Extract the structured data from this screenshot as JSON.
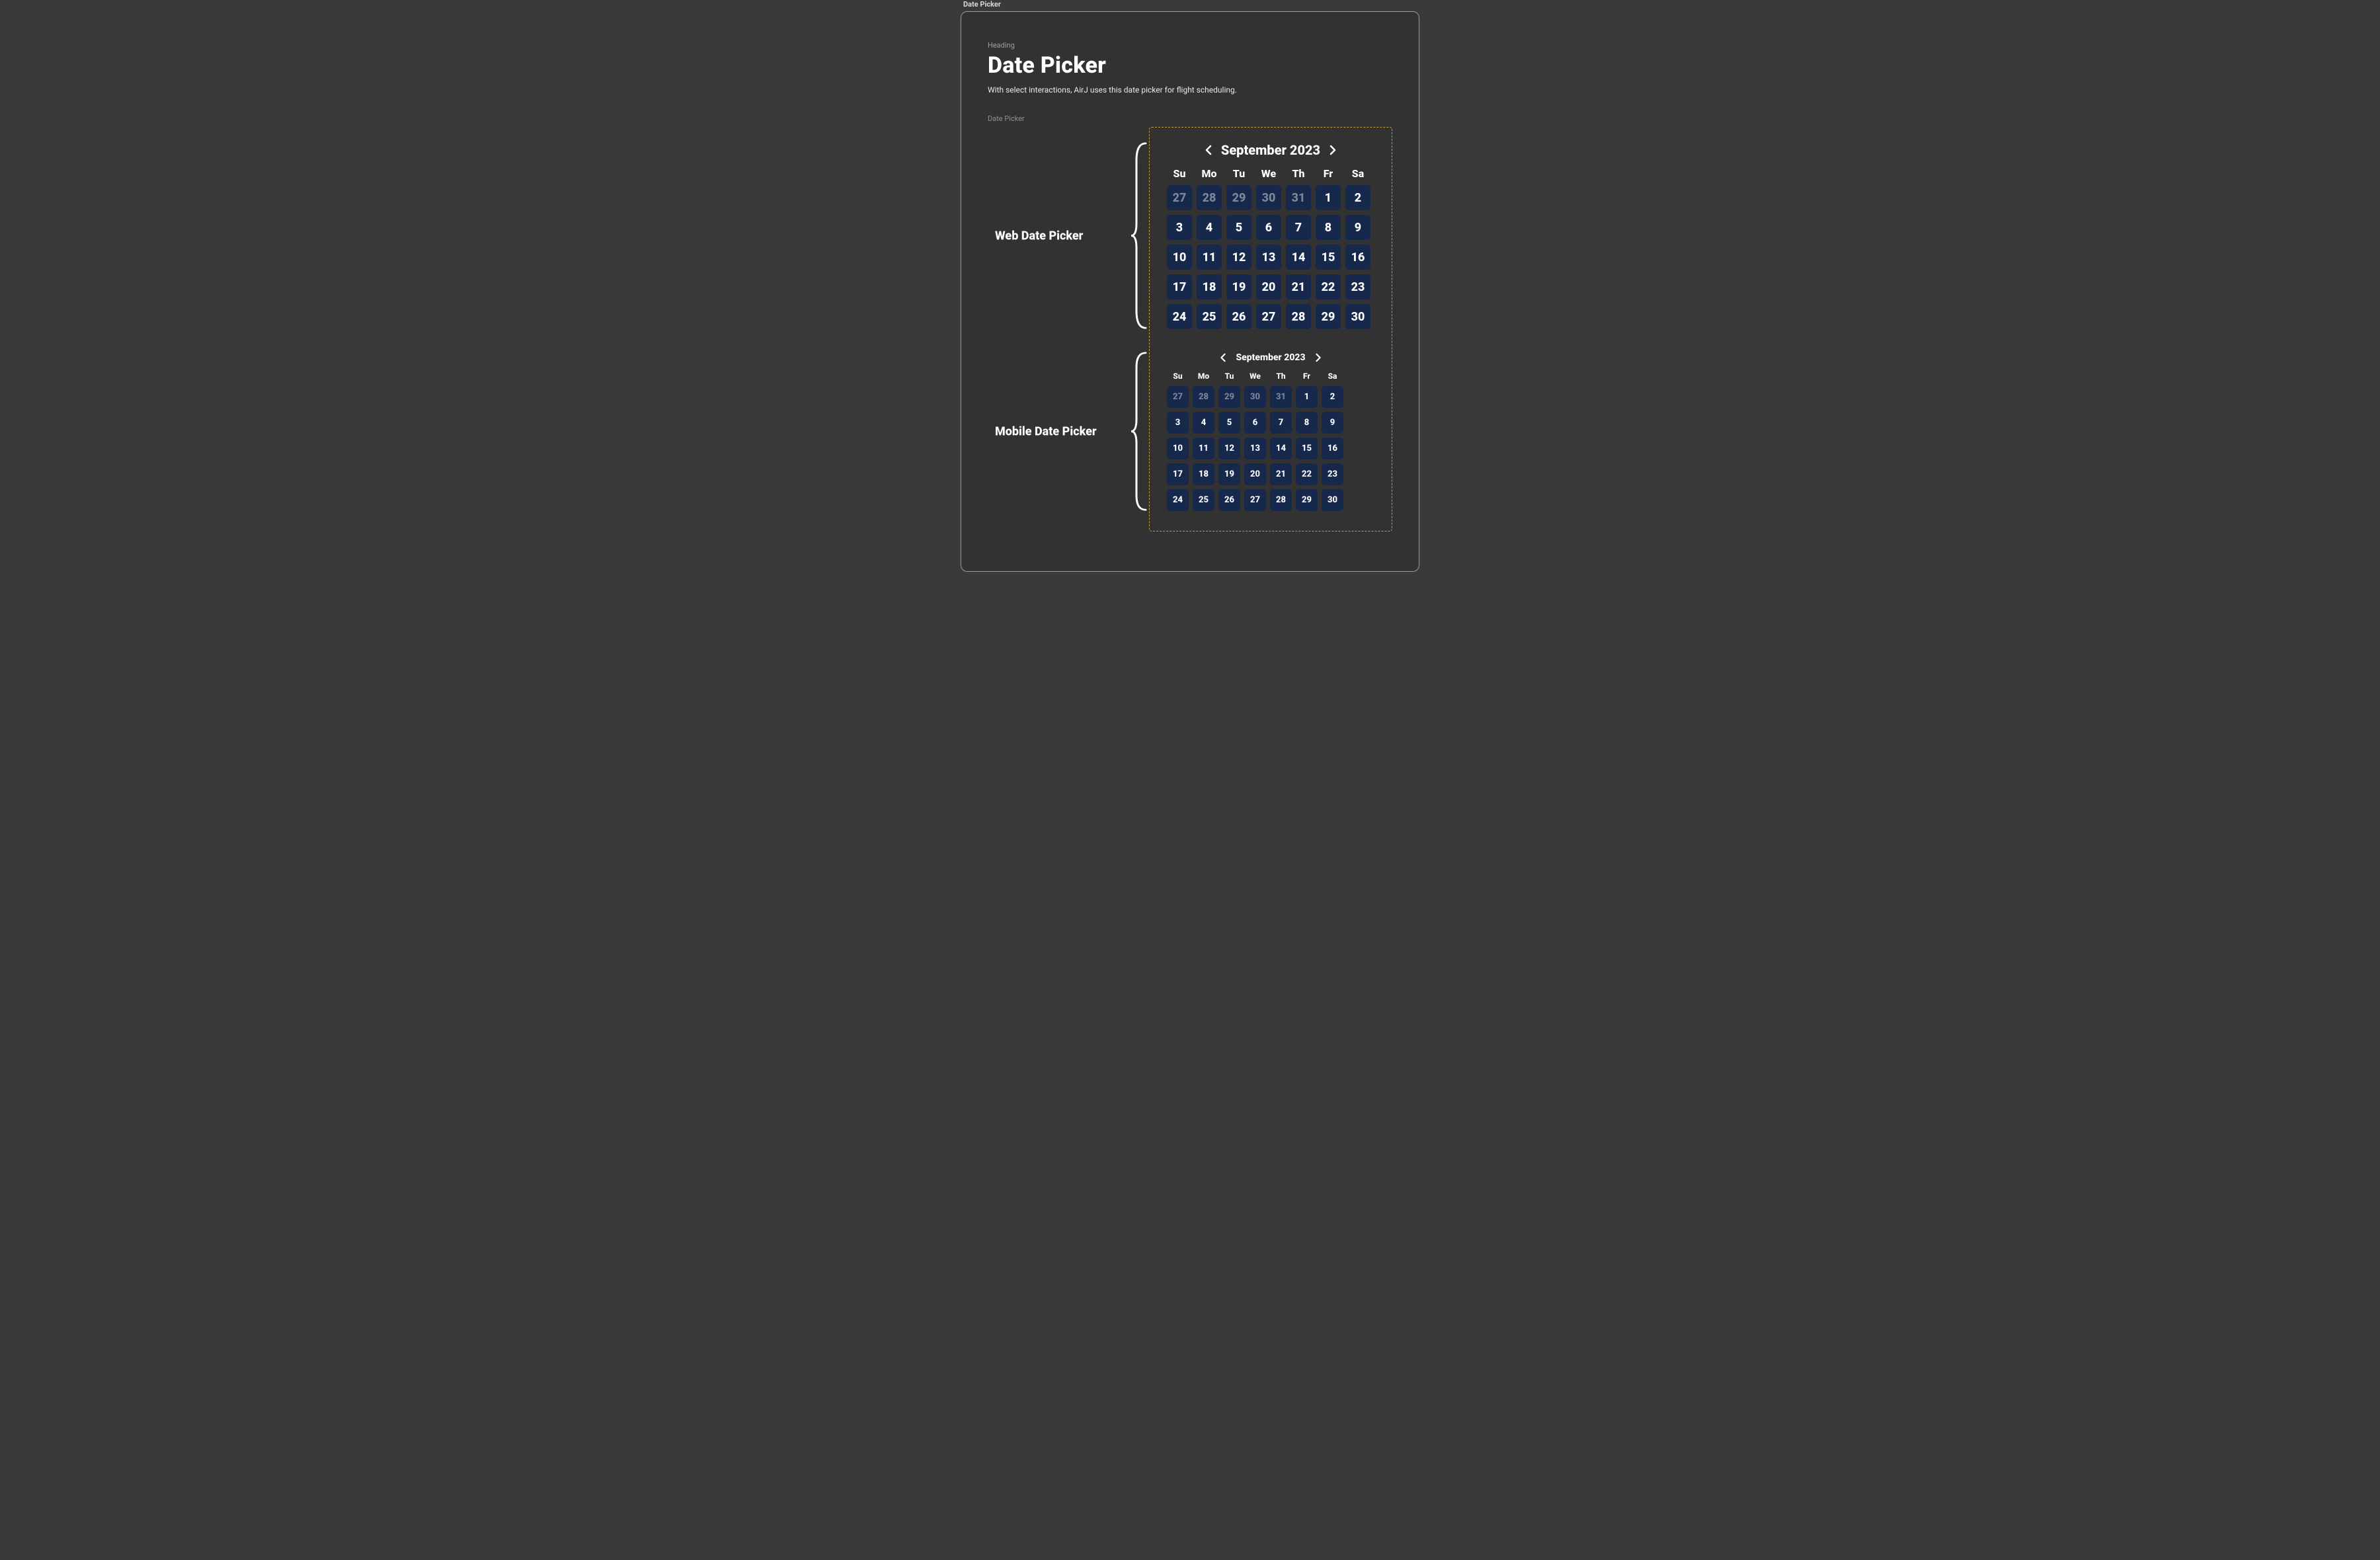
{
  "frame_label": "Date Picker",
  "header": {
    "eyebrow": "Heading",
    "title": "Date Picker",
    "subtitle": "With select interactions, AirJ uses this date picker for flight scheduling."
  },
  "section_label": "Date Picker",
  "colors": {
    "cell_bg": "#17284d",
    "dim_text": "#7d8797",
    "dashed_border": "#c99a3c"
  },
  "dow": [
    "Su",
    "Mo",
    "Tu",
    "We",
    "Th",
    "Fr",
    "Sa"
  ],
  "month_title": "September 2023",
  "days": [
    {
      "n": "27",
      "dim": true
    },
    {
      "n": "28",
      "dim": true
    },
    {
      "n": "29",
      "dim": true
    },
    {
      "n": "30",
      "dim": true
    },
    {
      "n": "31",
      "dim": true
    },
    {
      "n": "1"
    },
    {
      "n": "2"
    },
    {
      "n": "3"
    },
    {
      "n": "4"
    },
    {
      "n": "5"
    },
    {
      "n": "6"
    },
    {
      "n": "7"
    },
    {
      "n": "8"
    },
    {
      "n": "9"
    },
    {
      "n": "10"
    },
    {
      "n": "11"
    },
    {
      "n": "12"
    },
    {
      "n": "13"
    },
    {
      "n": "14"
    },
    {
      "n": "15"
    },
    {
      "n": "16"
    },
    {
      "n": "17"
    },
    {
      "n": "18"
    },
    {
      "n": "19"
    },
    {
      "n": "20"
    },
    {
      "n": "21"
    },
    {
      "n": "22"
    },
    {
      "n": "23"
    },
    {
      "n": "24"
    },
    {
      "n": "25"
    },
    {
      "n": "26"
    },
    {
      "n": "27"
    },
    {
      "n": "28"
    },
    {
      "n": "29"
    },
    {
      "n": "30"
    }
  ],
  "pickers": {
    "web": {
      "label": "Web Date Picker"
    },
    "mobile": {
      "label": "Mobile Date Picker"
    }
  }
}
